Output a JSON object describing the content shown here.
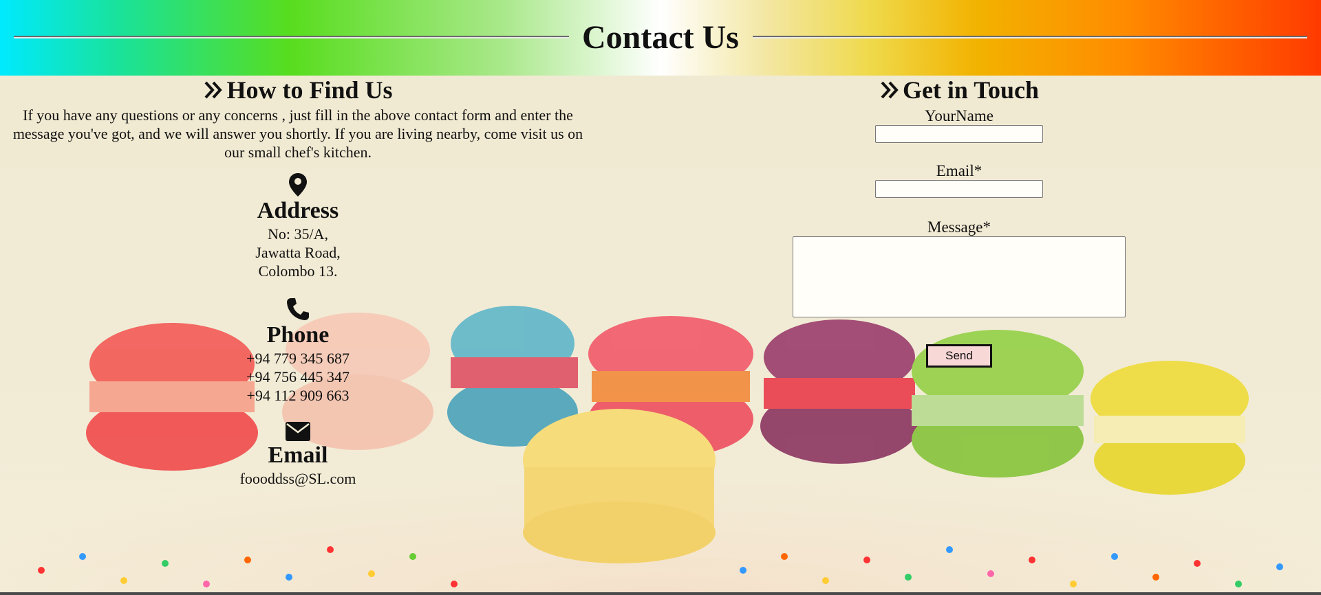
{
  "header": {
    "title": "Contact Us"
  },
  "find_us": {
    "title": "How to Find Us",
    "intro": "If you have any questions or any concerns , just fill in the above contact form and enter the message you've got, and we will answer you shortly. If you are living nearby, come visit us on our small chef's kitchen.",
    "address": {
      "icon": "map-pin-icon",
      "title": "Address",
      "lines": [
        "No: 35/A,",
        "Jawatta Road,",
        "Colombo 13."
      ]
    },
    "phone": {
      "icon": "phone-icon",
      "title": "Phone",
      "lines": [
        "+94 779 345 687",
        "+94 756 445 347",
        "+94 112 909 663"
      ]
    },
    "email": {
      "icon": "envelope-icon",
      "title": "Email",
      "lines": [
        "foooddss@SL.com"
      ]
    }
  },
  "get_in_touch": {
    "title": "Get in Touch",
    "name_label": "YourName",
    "name_value": "",
    "email_label": "Email*",
    "email_value": "",
    "message_label": "Message*",
    "message_value": "",
    "send_label": "Send"
  },
  "colors": {
    "send_button_bg": "#f8d7d7",
    "header_gradient": [
      "#00eaff",
      "#58dd1e",
      "#ffffff",
      "#efd94a",
      "#ff8c00",
      "#ff3a00"
    ]
  }
}
